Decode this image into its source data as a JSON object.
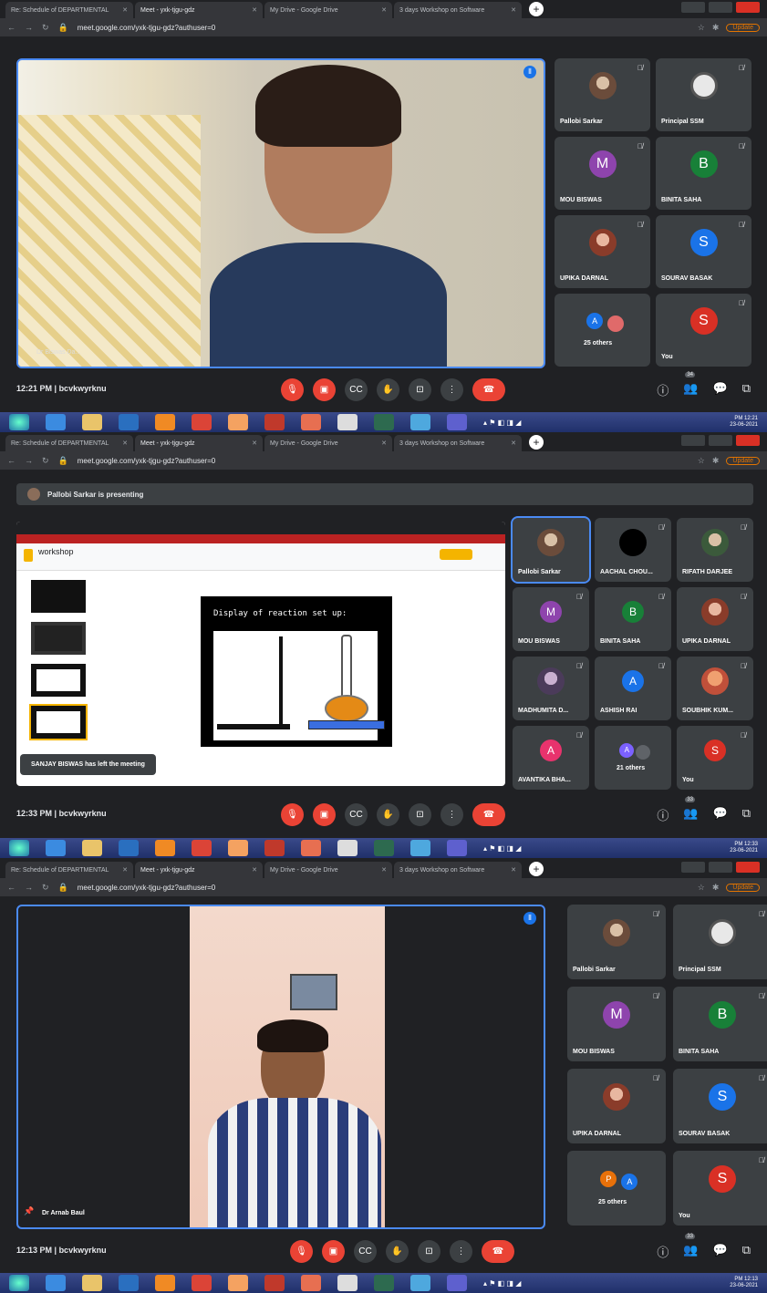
{
  "tabs": [
    {
      "label": "Re: Schedule of DEPARTMENTAL",
      "active": false
    },
    {
      "label": "Meet - yxk-tjgu-gdz",
      "active": true
    },
    {
      "label": "My Drive - Google Drive",
      "active": false
    },
    {
      "label": "3 days Workshop on Software",
      "active": false
    }
  ],
  "address": {
    "url_1": "meet.google.com/yxk-tjgu-gdz?authuser=0",
    "url_2": "meet.google.com/yxk-tjgu-gdz?authuser=0",
    "url_3": "meet.google.com/yxk-tjgu-gdz?authuser=0",
    "update_label": "Update"
  },
  "panel1": {
    "speaker_label": "Dr Biswas Da...",
    "time": "12:21 PM",
    "meeting_code": "bcvkwyrknu",
    "tiles": [
      {
        "name": "Pallobi Sarkar",
        "initial": "",
        "color": "#8a6d5a"
      },
      {
        "name": "Principal SSM",
        "initial": "",
        "color": "#e0e0e0"
      },
      {
        "name": "MOU BISWAS",
        "initial": "M",
        "color": "#8e44ad"
      },
      {
        "name": "BINITA SAHA",
        "initial": "B",
        "color": "#188038"
      },
      {
        "name": "UPIKA DARNAL",
        "initial": "",
        "color": "#a0522d"
      },
      {
        "name": "SOURAV BASAK",
        "initial": "S",
        "color": "#1a73e8"
      },
      {
        "name": "25 others",
        "initial": "A",
        "color": "#1a73e8"
      },
      {
        "name": "You",
        "initial": "S",
        "color": "#d93025"
      }
    ],
    "clock": "PM 12:21",
    "date": "23-06-2021",
    "participants": "34"
  },
  "panel2": {
    "banner": "Pallobi Sarkar is presenting",
    "slide_title": "workshop",
    "slide_heading": "Display of reaction set up:",
    "toast": "SANJAY BISWAS has left the meeting",
    "time": "12:33 PM",
    "meeting_code": "bcvkwyrknu",
    "tiles": [
      {
        "name": "Pallobi Sarkar",
        "initial": "",
        "color": "#8a6d5a"
      },
      {
        "name": "AACHAL CHOU...",
        "initial": "",
        "color": "#000000"
      },
      {
        "name": "RIFATH DARJEE",
        "initial": "",
        "color": "#5a7a4a"
      },
      {
        "name": "MOU BISWAS",
        "initial": "M",
        "color": "#8e44ad"
      },
      {
        "name": "BINITA SAHA",
        "initial": "B",
        "color": "#188038"
      },
      {
        "name": "UPIKA DARNAL",
        "initial": "",
        "color": "#a0522d"
      },
      {
        "name": "MADHUMITA D...",
        "initial": "",
        "color": "#6b5b7a"
      },
      {
        "name": "ASHISH RAI",
        "initial": "A",
        "color": "#1a73e8"
      },
      {
        "name": "SOUBHIK KUM...",
        "initial": "",
        "color": "#c0503a"
      },
      {
        "name": "AVANTIKA BHA...",
        "initial": "A",
        "color": "#e8336d"
      },
      {
        "name": "21 others",
        "initial": "A",
        "color": "#7b61ff"
      },
      {
        "name": "You",
        "initial": "S",
        "color": "#d93025"
      }
    ],
    "clock": "PM 12:33",
    "date": "23-06-2021",
    "participants": "33"
  },
  "panel3": {
    "speaker_label": "Dr Arnab Baul",
    "time": "12:13 PM",
    "meeting_code": "bcvkwyrknu",
    "tiles": [
      {
        "name": "Pallobi Sarkar",
        "initial": "",
        "color": "#8a6d5a"
      },
      {
        "name": "Principal SSM",
        "initial": "",
        "color": "#e0e0e0"
      },
      {
        "name": "MOU BISWAS",
        "initial": "M",
        "color": "#8e44ad"
      },
      {
        "name": "BINITA SAHA",
        "initial": "B",
        "color": "#188038"
      },
      {
        "name": "UPIKA DARNAL",
        "initial": "",
        "color": "#a0522d"
      },
      {
        "name": "SOURAV BASAK",
        "initial": "S",
        "color": "#1a73e8"
      },
      {
        "name": "25 others",
        "initial": "P",
        "color": "#e8710a"
      },
      {
        "name": "You",
        "initial": "S",
        "color": "#d93025"
      }
    ],
    "clock": "PM 12:13",
    "date": "23-06-2021",
    "participants": "33"
  }
}
